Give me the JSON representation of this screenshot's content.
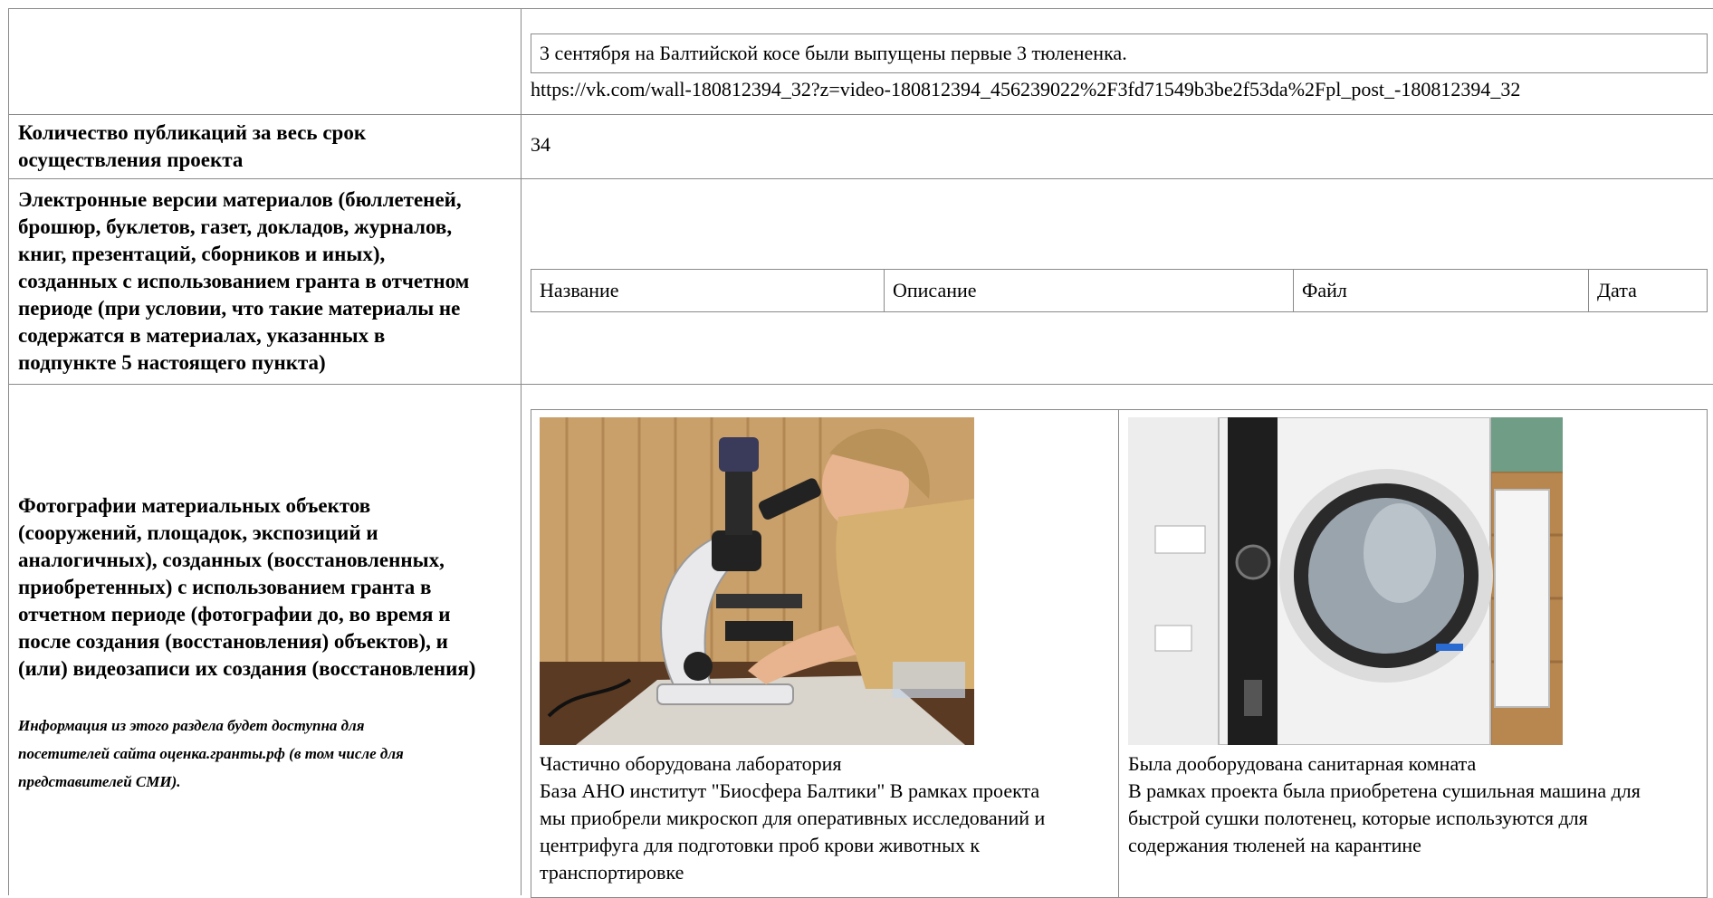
{
  "row_video": {
    "caption": "3 сентября на Балтийской косе были выпущены первые 3 тюлененка.",
    "url": "https://vk.com/wall-180812394_32?z=video-180812394_456239022%2F3fd71549b3be2f53da%2Fpl_post_-180812394_32"
  },
  "row_count": {
    "label_lines": [
      "Количество публикаций за весь срок",
      "осуществления проекта"
    ],
    "value": "34"
  },
  "row_materials": {
    "label_lines": [
      "Электронные версии материалов (бюллетеней,",
      "брошюр, буклетов, газет, докладов, журналов,",
      "книг, презентаций, сборников и иных),",
      "созданных с использованием гранта в отчетном",
      "периоде (при условии, что такие материалы не",
      "содержатся в материалах, указанных в",
      "подпункте 5 настоящего пункта)"
    ],
    "columns": [
      "Название",
      "Описание",
      "Файл",
      "Дата"
    ]
  },
  "row_photos": {
    "label_lines": [
      "Фотографии материальных объектов",
      "(сооружений, площадок, экспозиций и",
      "аналогичных), созданных (восстановленных,",
      "приобретенных) с использованием гранта в",
      "отчетном периоде (фотографии до, во время и",
      "после создания (восстановления) объектов), и",
      "(или) видеозаписи их создания (восстановления)"
    ],
    "note_lines": [
      "Информация из этого раздела будет доступна для",
      "посетителей сайта оценка.гранты.рф (в том числе для",
      "представителей СМИ)."
    ],
    "photos": [
      {
        "title": "Частично оборудована лаборатория",
        "desc_lines": [
          "База АНО институт \"Биосфера Балтики\" В рамках проекта",
          "мы приобрели микроскоп для оперативных исследований и",
          "центрифуга для подготовки проб крови животных к",
          "транспортировке"
        ],
        "image": "microscope-photo"
      },
      {
        "title": "Была дооборудована санитарная комната",
        "desc_lines": [
          "В рамках проекта была приобретена сушильная машина для",
          "быстрой сушки полотенец, которые используются для",
          "содержания тюленей на карантине"
        ],
        "image": "dryer-photo"
      }
    ]
  },
  "colors": {
    "border": "#8a8a8a",
    "wood": "#c9a06a",
    "microscope": "#e9e9ec",
    "tile": "#b8874f",
    "dryer": "#f2f2f2"
  }
}
